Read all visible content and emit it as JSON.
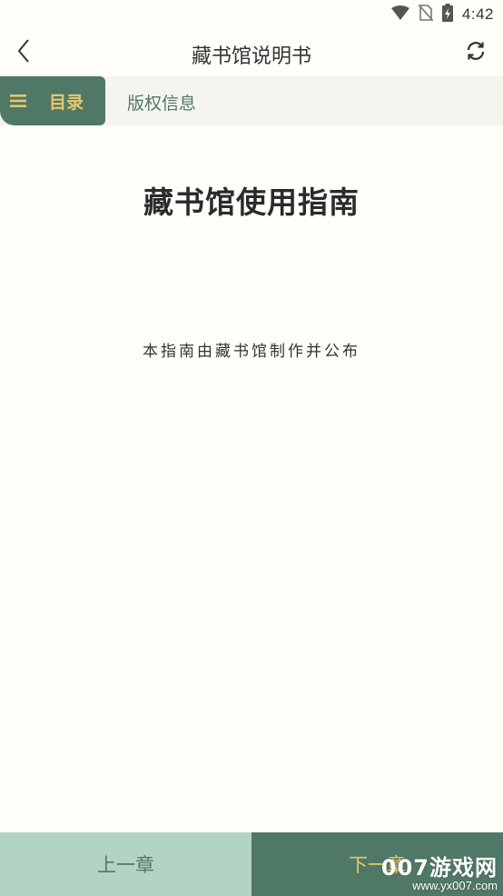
{
  "status_bar": {
    "time": "4:42",
    "icons": [
      "wifi-icon",
      "no-sim-icon",
      "battery-charging-icon"
    ]
  },
  "header": {
    "title": "藏书馆说明书",
    "back_icon": "chevron-left-icon",
    "refresh_icon": "refresh-icon"
  },
  "tabs": {
    "catalog_label": "目录",
    "catalog_icon": "menu-icon",
    "copyright_label": "版权信息"
  },
  "content": {
    "title": "藏书馆使用指南",
    "subtitle": "本指南由藏书馆制作并公布"
  },
  "footer": {
    "prev_label": "上一章",
    "next_label": "下一章"
  },
  "watermark": {
    "main": "007游戏网",
    "url": "www.yx007.com"
  },
  "colors": {
    "background": "#fffef9",
    "primary_green": "#507866",
    "light_green": "#b3d3c3",
    "gold": "#e6c86b",
    "text_green": "#4f7a67"
  }
}
